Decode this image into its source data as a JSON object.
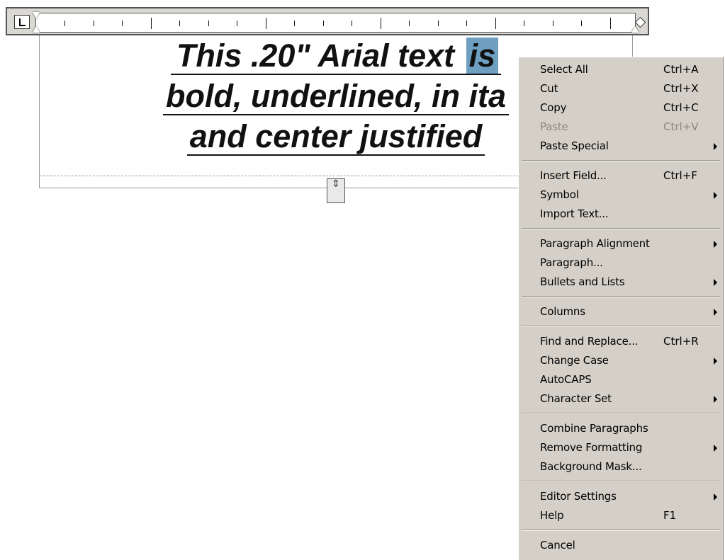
{
  "editor": {
    "text_lines": [
      "This .20\" Arial text ",
      "bold, underlined, in ita",
      "and center justified"
    ],
    "selected_word": "is",
    "height_handle_glyph": "⇕"
  },
  "context_menu": {
    "groups": [
      [
        {
          "label": "Select All",
          "shortcut": "Ctrl+A"
        },
        {
          "label": "Cut",
          "shortcut": "Ctrl+X"
        },
        {
          "label": "Copy",
          "shortcut": "Ctrl+C"
        },
        {
          "label": "Paste",
          "shortcut": "Ctrl+V",
          "disabled": true
        },
        {
          "label": "Paste Special",
          "submenu": true
        }
      ],
      [
        {
          "label": "Insert Field...",
          "shortcut": "Ctrl+F"
        },
        {
          "label": "Symbol",
          "submenu": true
        },
        {
          "label": "Import Text..."
        }
      ],
      [
        {
          "label": "Paragraph Alignment",
          "submenu": true
        },
        {
          "label": "Paragraph..."
        },
        {
          "label": "Bullets and Lists",
          "submenu": true
        }
      ],
      [
        {
          "label": "Columns",
          "submenu": true
        }
      ],
      [
        {
          "label": "Find and Replace...",
          "shortcut": "Ctrl+R"
        },
        {
          "label": "Change Case",
          "submenu": true
        },
        {
          "label": "AutoCAPS"
        },
        {
          "label": "Character Set",
          "submenu": true
        }
      ],
      [
        {
          "label": "Combine Paragraphs"
        },
        {
          "label": "Remove Formatting",
          "submenu": true
        },
        {
          "label": "Background Mask..."
        }
      ],
      [
        {
          "label": "Editor Settings",
          "submenu": true
        },
        {
          "label": "Help",
          "shortcut": "F1"
        }
      ],
      [
        {
          "label": "Cancel"
        }
      ]
    ]
  }
}
